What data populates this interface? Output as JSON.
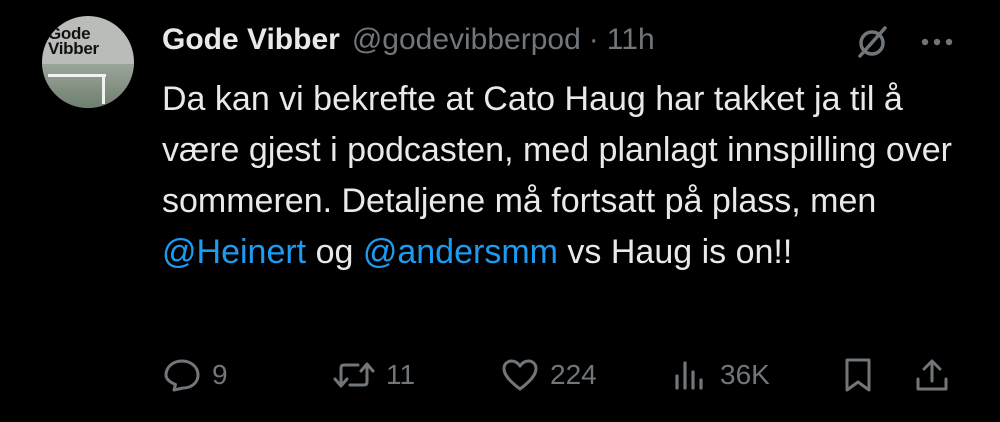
{
  "author": {
    "avatar_text_line1": "Gode",
    "avatar_text_line2": "Vibber",
    "display_name": "Gode Vibber",
    "handle": "@godevibberpod",
    "separator": "·",
    "time": "11h"
  },
  "tweet": {
    "text_part1": "Da kan vi bekrefte at Cato Haug har takket ja til å være gjest i podcasten, med planlagt innspilling over sommeren. Detaljene må fortsatt på plass, men ",
    "mention1": "@Heinert",
    "text_part2": " og ",
    "mention2": "@andersmm",
    "text_part3": " vs Haug is on!!"
  },
  "actions": {
    "replies": "9",
    "reposts": "11",
    "likes": "224",
    "views": "36K"
  },
  "icons": {
    "reply": "speech-bubble-icon",
    "repost": "repost-arrows-icon",
    "like": "heart-icon",
    "views": "bar-chart-icon",
    "bookmark": "bookmark-icon",
    "share": "share-upload-icon",
    "grok": "grok-slash-circle-icon",
    "more": "more-dots-icon"
  },
  "colors": {
    "background": "#000000",
    "primary_text": "#e7e9ea",
    "secondary_text": "#71767b",
    "link": "#1d9bf0"
  }
}
